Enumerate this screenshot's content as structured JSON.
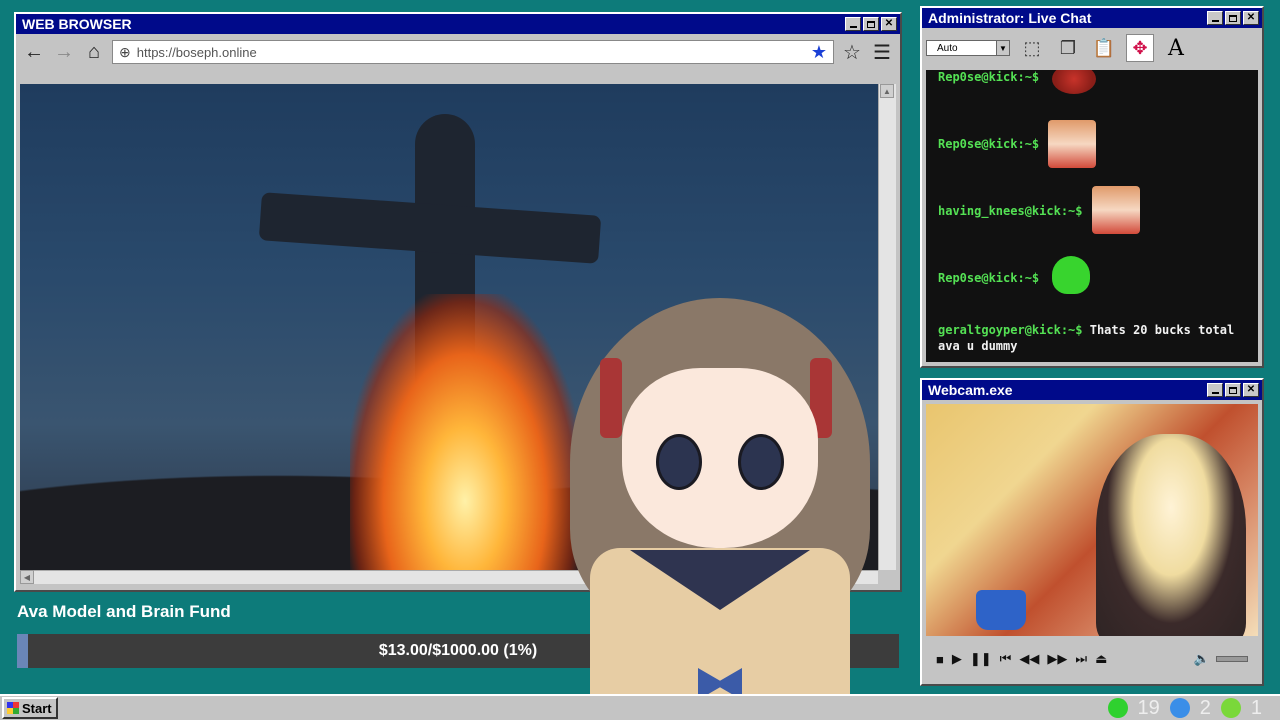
{
  "browser": {
    "title": "WEB BROWSER",
    "url": "https://boseph.online",
    "nav": {
      "back": "←",
      "forward": "→",
      "home": "⌂",
      "bookmark": "★",
      "favorite": "☆",
      "menu": "☰"
    }
  },
  "chat": {
    "title": "Administrator: Live Chat",
    "font_select": "Auto",
    "messages": [
      {
        "user": "Rep0se@kick:~$",
        "text": "",
        "emote": "red-blob"
      },
      {
        "user": "Rep0se@kick:~$",
        "text": "",
        "emote": "anime-girl"
      },
      {
        "user": "having_knees@kick:~$",
        "text": "",
        "emote": "anime-girl"
      },
      {
        "user": "Rep0se@kick:~$",
        "text": "",
        "emote": "green-ghost"
      },
      {
        "user": "geraltgoyper@kick:~$",
        "text": "Thats 20 bucks total ava u dummy"
      }
    ]
  },
  "webcam": {
    "title": "Webcam.exe"
  },
  "fund": {
    "title": "Ava Model and Brain Fund",
    "progress_text": "$13.00/$1000.00 (1%)",
    "progress": 0.013
  },
  "taskbar": {
    "start": "Start",
    "tray_count_1": "19",
    "tray_count_2": "2",
    "tray_count_3": "1"
  },
  "colors": {
    "desktop": "#0d7b7a",
    "titlebar": "#000a8a",
    "chat_username": "#54e154",
    "bookmark_star": "#1a3fd6"
  }
}
